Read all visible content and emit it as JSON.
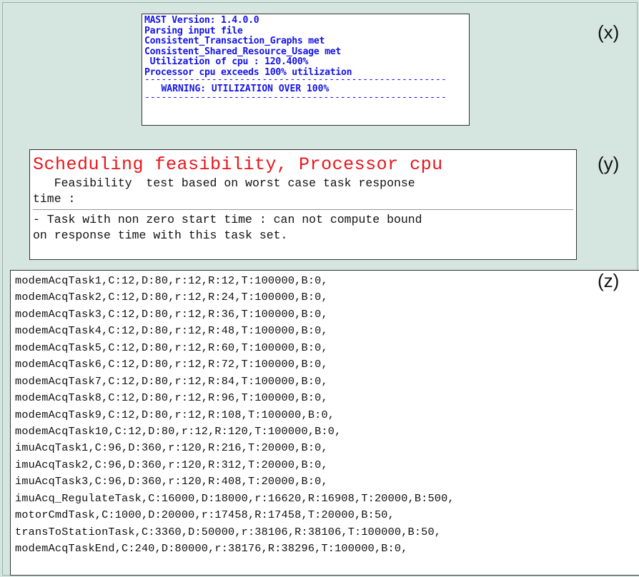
{
  "labels": {
    "x": "(x)",
    "y": "(y)",
    "z": "(z)"
  },
  "mast_panel": {
    "lines": [
      "MAST Version: 1.4.0.0",
      "Parsing input file",
      "Consistent_Transaction_Graphs met",
      "Consistent_Shared_Resource_Usage met",
      " Utilization of cpu : 120.400%",
      "Processor cpu exceeds 100% utilization"
    ],
    "separator": "------------------------------------------------------",
    "warning": "   WARNING: UTILIZATION OVER 100%",
    "text_color": "#1414e8"
  },
  "feasibility_panel": {
    "title": "Scheduling feasibility, Processor cpu",
    "title_color": "#e8161c",
    "test_line_1": "   Feasibility  test based on worst case task response",
    "test_line_2": "time :",
    "result_line_1": "- Task with non zero start time : can not compute bound",
    "result_line_2": "on response time with this task set."
  },
  "task_panel": {
    "rows": [
      "modemAcqTask1,C:12,D:80,r:12,R:12,T:100000,B:0,",
      "modemAcqTask2,C:12,D:80,r:12,R:24,T:100000,B:0,",
      "modemAcqTask3,C:12,D:80,r:12,R:36,T:100000,B:0,",
      "modemAcqTask4,C:12,D:80,r:12,R:48,T:100000,B:0,",
      "modemAcqTask5,C:12,D:80,r:12,R:60,T:100000,B:0,",
      "modemAcqTask6,C:12,D:80,r:12,R:72,T:100000,B:0,",
      "modemAcqTask7,C:12,D:80,r:12,R:84,T:100000,B:0,",
      "modemAcqTask8,C:12,D:80,r:12,R:96,T:100000,B:0,",
      "modemAcqTask9,C:12,D:80,r:12,R:108,T:100000,B:0,",
      "modemAcqTask10,C:12,D:80,r:12,R:120,T:100000,B:0,",
      "imuAcqTask1,C:96,D:360,r:120,R:216,T:20000,B:0,",
      "imuAcqTask2,C:96,D:360,r:120,R:312,T:20000,B:0,",
      "imuAcqTask3,C:96,D:360,r:120,R:408,T:20000,B:0,",
      "imuAcq_RegulateTask,C:16000,D:18000,r:16620,R:16908,T:20000,B:500,",
      "motorCmdTask,C:1000,D:20000,r:17458,R:17458,T:20000,B:50,",
      "transToStationTask,C:3360,D:50000,r:38106,R:38106,T:100000,B:50,",
      "modemAcqTaskEnd,C:240,D:80000,r:38176,R:38296,T:100000,B:0,"
    ]
  }
}
